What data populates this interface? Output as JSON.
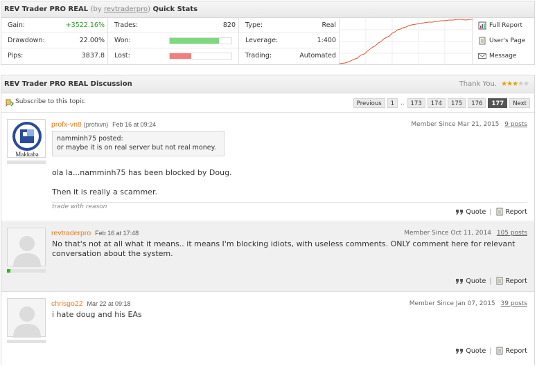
{
  "stats": {
    "title_name": "REV Trader PRO REAL",
    "title_by": "(by ",
    "title_user": "revtraderpro",
    "title_close": ")",
    "title_suffix": "Quick Stats",
    "col1": [
      {
        "label": "Gain:",
        "value": "+3522.16%"
      },
      {
        "label": "Drawdown:",
        "value": "22.00%"
      },
      {
        "label": "Pips:",
        "value": "3837.8"
      }
    ],
    "trades_label": "Trades:",
    "trades_value": "820",
    "won_label": "Won:",
    "won_fraction": 0.8,
    "lost_label": "Lost:",
    "lost_fraction": 0.35,
    "won_color": "#7ed87e",
    "lost_color": "#f08080",
    "col3": [
      {
        "label": "Type:",
        "value": "Real"
      },
      {
        "label": "Leverage:",
        "value": "1:400"
      },
      {
        "label": "Trading:",
        "value": "Automated"
      }
    ],
    "links": {
      "full_report": "Full Report",
      "users_page": "User's Page",
      "message": "Message"
    }
  },
  "discussion": {
    "title": "REV Trader PRO REAL Discussion",
    "thank_you": "Thank You.",
    "rating_stars": 3,
    "rating_max": 5,
    "subscribe": "Subscribe to this topic",
    "pager": {
      "previous": "Previous",
      "first": "1",
      "ellipsis": "..",
      "pages": [
        "173",
        "174",
        "175",
        "176"
      ],
      "current": "177",
      "next": "Next"
    }
  },
  "posts": [
    {
      "author": "profx-vn8",
      "username": "(profxvn)",
      "date": "Feb 16 at 09:24",
      "member_since": "Member Since Mar 21, 2015",
      "post_count": "9 posts",
      "avatar_text": "Makkaba",
      "quote_line1": "namminh75 posted:",
      "quote_line2": "or maybe it is on real server but not real money.",
      "body_line1": "ola la...namminh75 has been blocked by Doug.",
      "body_line2": "Then it is really a scammer.",
      "reason": "trade with reason",
      "quote": "Quote",
      "report": "Report"
    },
    {
      "author": "revtraderpro",
      "date": "Feb 16 at 17:48",
      "member_since": "Member Since Oct 11, 2014",
      "post_count": "105 posts",
      "body": "No that's not at all what it means.. it means I'm blocking idiots, with useless comments. ONLY comment here for relevant conversation about the system.",
      "quote": "Quote",
      "report": "Report"
    },
    {
      "author": "chrisgo22",
      "date": "Mar 22 at 09:18",
      "member_since": "Member Since Jan 07, 2015",
      "post_count": "39 posts",
      "body": "i hate doug and his EAs",
      "quote": "Quote",
      "report": "Report"
    }
  ]
}
